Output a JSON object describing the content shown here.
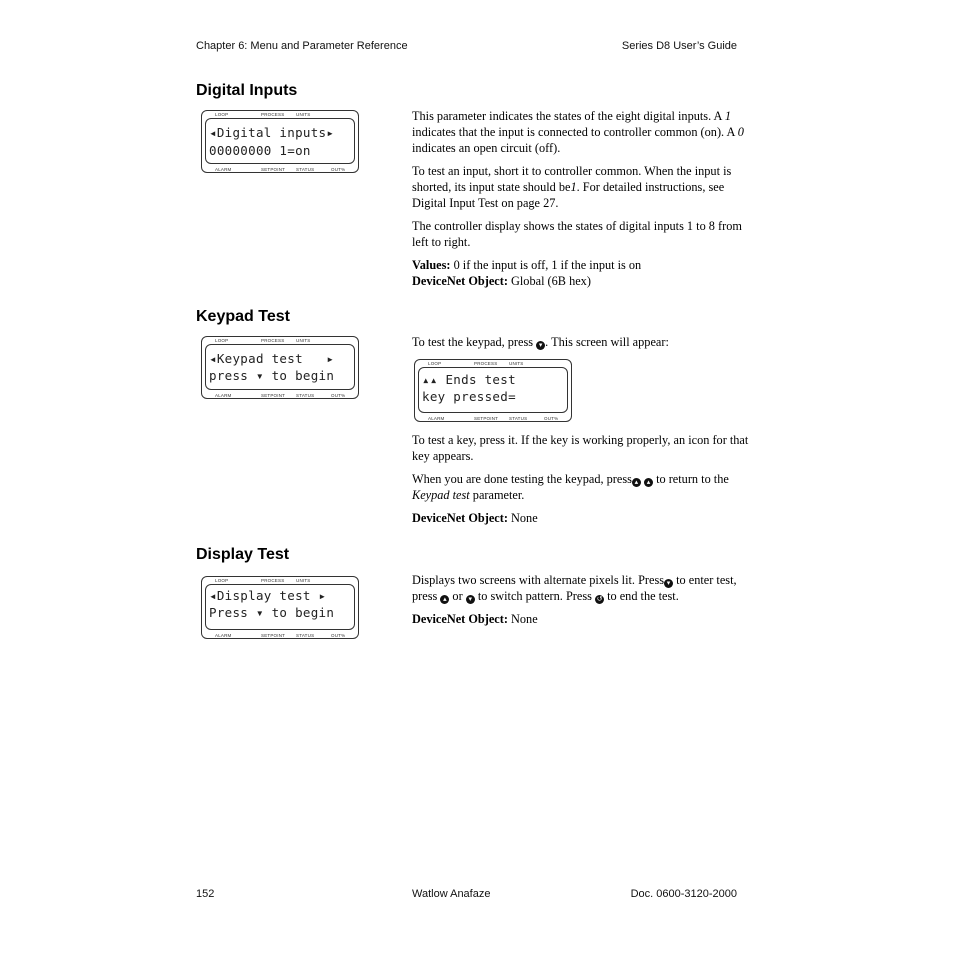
{
  "header": {
    "left": "Chapter 6: Menu and Parameter Reference",
    "right": "Series D8 User’s Guide"
  },
  "footer": {
    "page": "152",
    "center": "Watlow Anafaze",
    "doc": "Doc. 0600-3120-2000"
  },
  "lcd_labels": {
    "loop": "LOOP",
    "process": "PROCESS",
    "units": "UNITS",
    "alarm": "ALARM",
    "setpoint": "SETPOINT",
    "status": "STATUS",
    "out": "OUT%"
  },
  "sections": [
    {
      "title": "Digital Inputs",
      "lcd": {
        "line1": "◂Digital inputs▸",
        "line2": "00000000 1=on"
      },
      "p1": "This parameter indicates the states of the eight digital inputs. A ",
      "p1_i1": "1",
      "p1_b": " indicates that the input is connected to controller common (on). A ",
      "p1_i2": "0",
      "p1_c": " indicates an open circuit (off).",
      "p2": "To test an input, short it to controller common. When the input is shorted, its input state should be",
      "p2_i": "1",
      "p2_b": ". For detailed instructions, see Digital Input Test on page 27.",
      "p3": "The controller display shows the states of digital inputs 1 to 8 from left to right.",
      "values_label": "Values:",
      "values_text": " 0 if the input is off, 1 if the input is on",
      "dn_label": "DeviceNet Object:",
      "dn_text": " Global (6B hex)"
    },
    {
      "title": "Keypad Test",
      "lcd": {
        "line1": "◂Keypad test   ▸",
        "line2": "press ▾ to begin"
      },
      "p1a": "To test the keypad, press ",
      "p1b": ". This screen will appear:",
      "lcd2": {
        "line1": "▴▴ Ends test",
        "line2": "key pressed="
      },
      "p2": "To test a key, press it. If the key is working properly, an icon for that key appears.",
      "p3a": "When you are done testing the keypad, press",
      "p3b": " to return to the ",
      "p3_i": "Keypad test",
      "p3c": " parameter.",
      "dn_label": "DeviceNet Object:",
      "dn_text": " None"
    },
    {
      "title": "Display Test",
      "lcd": {
        "line1": "◂Display test ▸",
        "line2": "Press ▾ to begin"
      },
      "p1a": "Displays two screens with alternate pixels lit. Press",
      "p1b": " to enter test, press ",
      "p1c": " or ",
      "p1d": " to switch pattern. Press ",
      "p1e": " to end the test.",
      "dn_label": "DeviceNet Object:",
      "dn_text": " None"
    }
  ],
  "icons": {
    "down": "▾",
    "up": "▴",
    "back": "↺"
  }
}
